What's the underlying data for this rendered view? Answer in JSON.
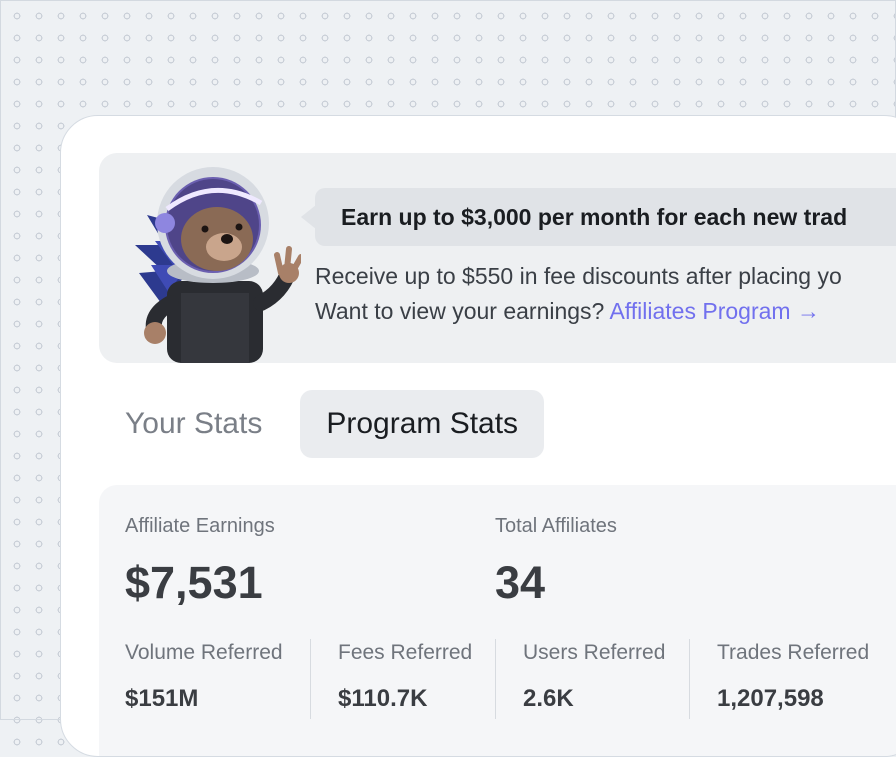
{
  "banner": {
    "headline": "Earn up to $3,000 per month for each new trad",
    "line1": "Receive up to $550 in fee discounts after placing yo",
    "line2_prefix": "Want to view your earnings? ",
    "link_text": "Affiliates Program →"
  },
  "tabs": [
    {
      "label": "Your Stats",
      "active": false
    },
    {
      "label": "Program Stats",
      "active": true
    }
  ],
  "stats": {
    "affiliate_earnings": {
      "label": "Affiliate Earnings",
      "value": "$7,531"
    },
    "total_affiliates": {
      "label": "Total Affiliates",
      "value": "34"
    },
    "metrics": [
      {
        "label": "Volume Referred",
        "value": "$151M"
      },
      {
        "label": "Fees Referred",
        "value": "$110.7K"
      },
      {
        "label": "Users Referred",
        "value": "2.6K"
      },
      {
        "label": "Trades Referred",
        "value": "1,207,598"
      }
    ]
  },
  "colors": {
    "accent_link": "#7170ee",
    "background": "#eef1f4",
    "card": "#ffffff"
  },
  "icons": {
    "mascot": "astronaut-hedgehog-mascot"
  }
}
